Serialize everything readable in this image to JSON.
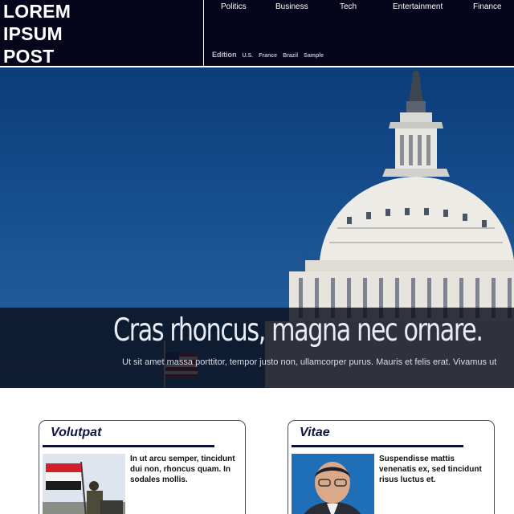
{
  "header": {
    "logo_lines": [
      "LOREM",
      "IPSUM",
      "POST"
    ],
    "nav": [
      "Politics",
      "Business",
      "Tech",
      "Entertainment",
      "Finance"
    ],
    "edition_label": "Edition",
    "editions": [
      "U.S.",
      "France",
      "Brazil",
      "Sample"
    ],
    "background_color": "#05061c"
  },
  "hero": {
    "title": "Cras rhoncus, magna nec ornare.",
    "subtitle": "Ut sit amet massa porttitor, tempor justo non, ullamcorper purus. Mauris et felis erat. Vivamus ut",
    "image": "capitol-dome-photo"
  },
  "cards": [
    {
      "title": "Volutpat",
      "text": "In ut arcu semper, tincidunt dui non, rhoncus quam. In sodales mollis.",
      "image": "soldier-with-flag-photo"
    },
    {
      "title": "Vitae",
      "text": "Suspendisse mattis venenatis ex, sed tincidunt risus luctus et.",
      "image": "man-portrait-photo"
    }
  ],
  "colors": {
    "accent_navy": "#0a0f3a",
    "card_title": "#0e1440"
  }
}
